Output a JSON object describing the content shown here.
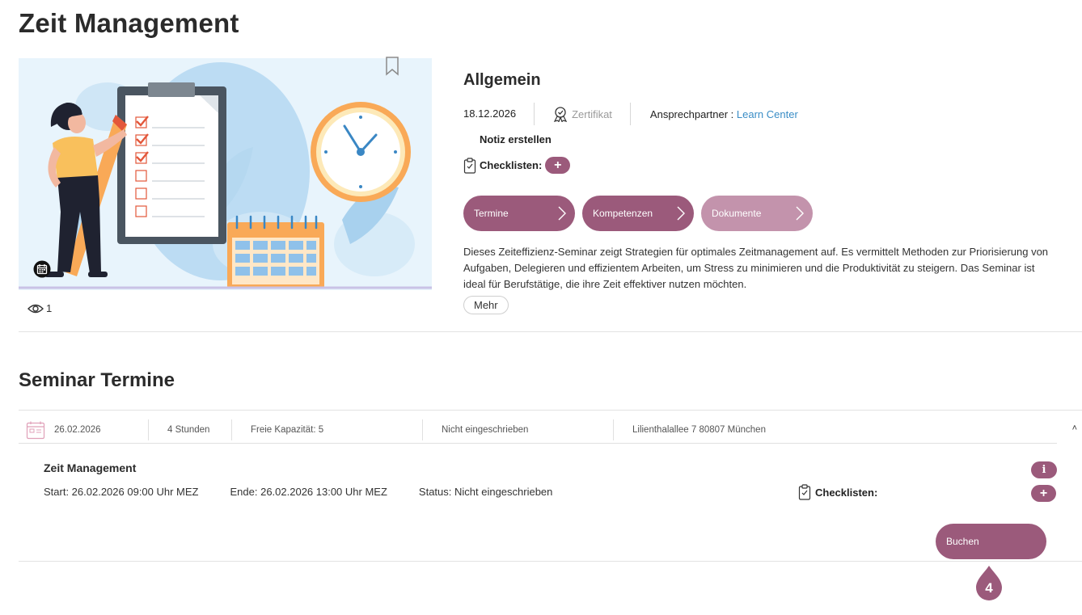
{
  "page": {
    "title": "Zeit Management"
  },
  "hero": {
    "views_count": "1"
  },
  "info": {
    "heading": "Allgemein",
    "date": "18.12.2026",
    "certificate_label": "Zertifikat",
    "contact_label": "Ansprechpartner :",
    "contact_link": "Learn Center",
    "note_label": "Notiz erstellen",
    "checklist_label": "Checklisten:",
    "plus_label": "+",
    "tabs": [
      {
        "label": "Termine"
      },
      {
        "label": "Kompetenzen"
      },
      {
        "label": "Dokumente"
      }
    ],
    "description": "Dieses Zeiteffizienz-Seminar zeigt Strategien für optimales Zeitmanagement auf. Es vermittelt Methoden zur Priorisierung von Aufgaben, Delegieren und effizientem Arbeiten, um Stress zu minimieren und die Produktivität zu steigern. Das Seminar ist ideal für Berufstätige, die ihre Zeit effektiver nutzen möchten.",
    "more_label": "Mehr"
  },
  "seminar": {
    "section_title": "Seminar Termine",
    "termin": {
      "date": "26.02.2026",
      "duration": "4 Stunden",
      "capacity": "Freie Kapazität: 5",
      "enrollment": "Nicht eingeschrieben",
      "location": "Lilienthalallee 7 80807 München",
      "collapse_symbol": "˄",
      "title": "Zeit Management",
      "start": "Start: 26.02.2026 09:00 Uhr MEZ",
      "end": "Ende: 26.02.2026 13:00 Uhr MEZ",
      "status": "Status: Nicht eingeschrieben",
      "checklist_label": "Checklisten:",
      "info_label": "i",
      "plus_label": "+",
      "book_label": "Buchen"
    }
  },
  "marker": {
    "number": "4"
  },
  "colors": {
    "accent": "#9b5a7b",
    "accent_muted": "#c393ac",
    "link": "#3a8dc6"
  }
}
